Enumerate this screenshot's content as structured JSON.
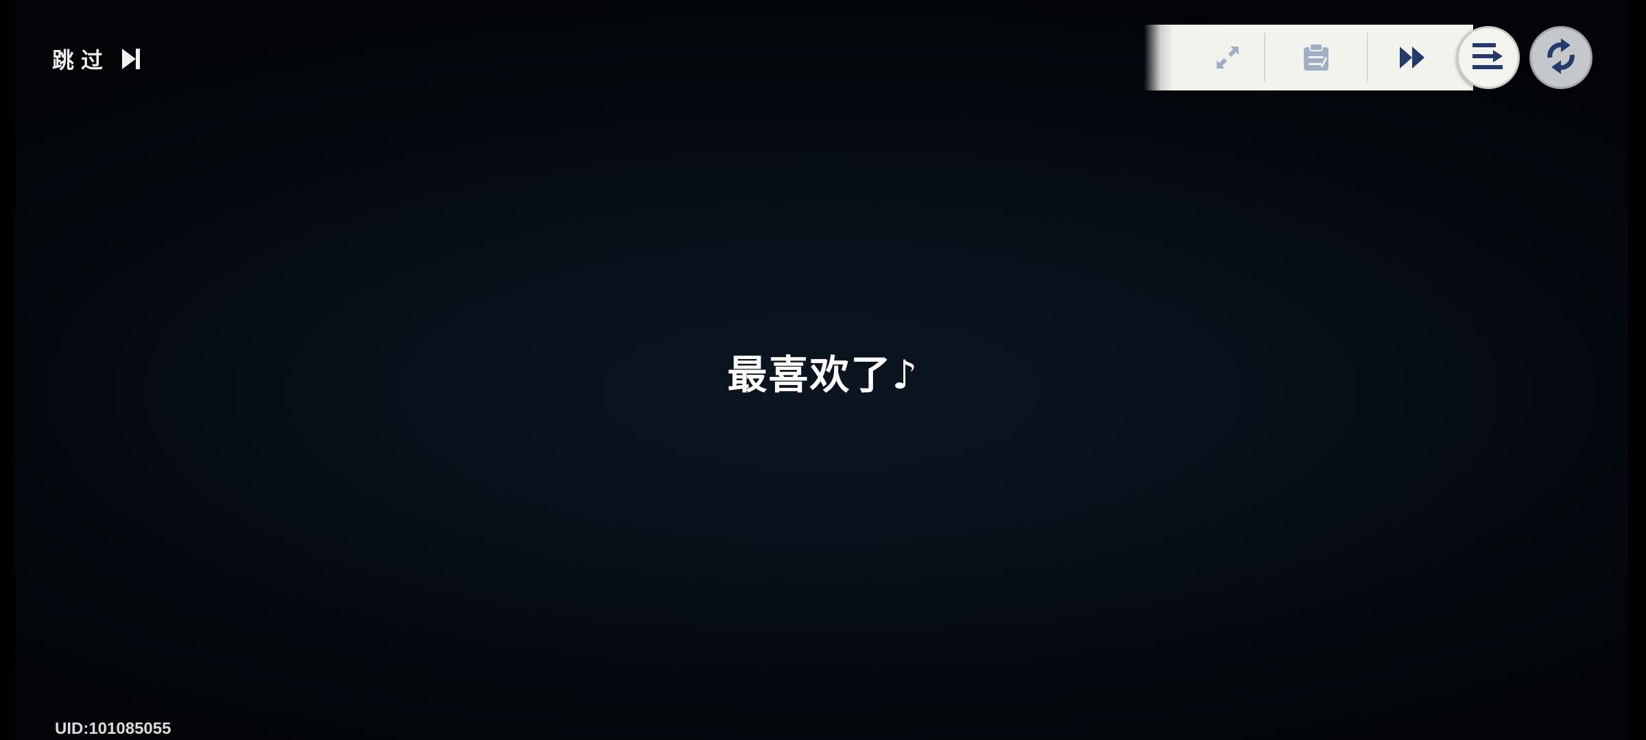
{
  "skip": {
    "label": "跳过",
    "icon": "skip-forward-icon"
  },
  "toolbar": {
    "buttons": [
      {
        "name": "expand",
        "icon": "expand-arrows-icon"
      },
      {
        "name": "log",
        "icon": "clipboard-log-icon"
      },
      {
        "name": "fast-forward",
        "icon": "fast-forward-icon"
      },
      {
        "name": "menu",
        "icon": "menu-arrow-icon"
      },
      {
        "name": "auto",
        "icon": "sync-icon"
      }
    ]
  },
  "dialogue": {
    "text": "最喜欢了♪"
  },
  "footer": {
    "uid": "UID:101085055"
  },
  "colors": {
    "toolbar_bg": "#f3f3ee",
    "icon_muted": "#9fb0c4",
    "icon_dark": "#233a6b",
    "sync_bg": "#c5c8cb"
  }
}
